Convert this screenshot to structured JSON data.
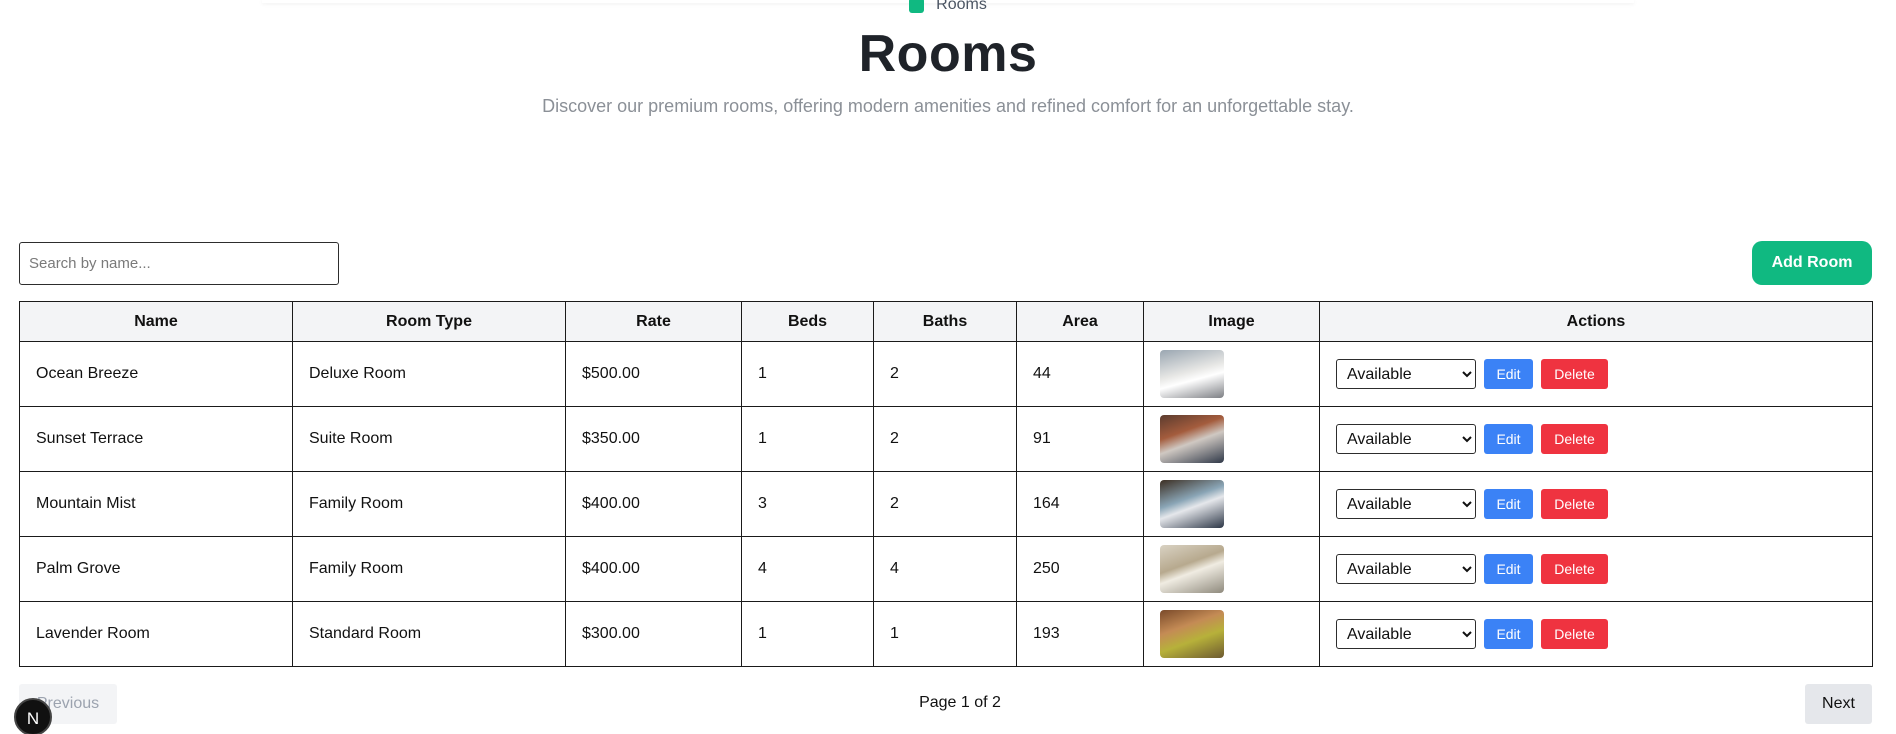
{
  "header": {
    "breadcrumb": {
      "label": "Rooms",
      "icon": "square-icon",
      "icon_color": "#10b981"
    },
    "title": "Rooms",
    "subtitle": "Discover our premium rooms, offering modern amenities and refined comfort for an unforgettable stay."
  },
  "toolbar": {
    "search_placeholder": "Search by name...",
    "search_value": "",
    "add_label": "Add Room",
    "accent": "#10b981"
  },
  "table": {
    "columns": [
      "Name",
      "Room Type",
      "Rate",
      "Beds",
      "Baths",
      "Area",
      "Image",
      "Actions"
    ],
    "rows": [
      {
        "name": "Ocean Breeze",
        "type": "Deluxe Room",
        "rate": "$500.00",
        "beds": "1",
        "baths": "2",
        "area": "44",
        "status": "Available"
      },
      {
        "name": "Sunset Terrace",
        "type": "Suite Room",
        "rate": "$350.00",
        "beds": "1",
        "baths": "2",
        "area": "91",
        "status": "Available"
      },
      {
        "name": "Mountain Mist",
        "type": "Family Room",
        "rate": "$400.00",
        "beds": "3",
        "baths": "2",
        "area": "164",
        "status": "Available"
      },
      {
        "name": "Palm Grove",
        "type": "Family Room",
        "rate": "$400.00",
        "beds": "4",
        "baths": "4",
        "area": "250",
        "status": "Available"
      },
      {
        "name": "Lavender Room",
        "type": "Standard Room",
        "rate": "$300.00",
        "beds": "1",
        "baths": "1",
        "area": "193",
        "status": "Available"
      }
    ],
    "edit_label": "Edit",
    "delete_label": "Delete",
    "edit_color": "#3b82f6",
    "delete_color": "#ef3340"
  },
  "pagination": {
    "previous_label": "Previous",
    "page_info": "Page 1 of 2",
    "next_label": "Next"
  },
  "badge": {
    "label": "N"
  }
}
